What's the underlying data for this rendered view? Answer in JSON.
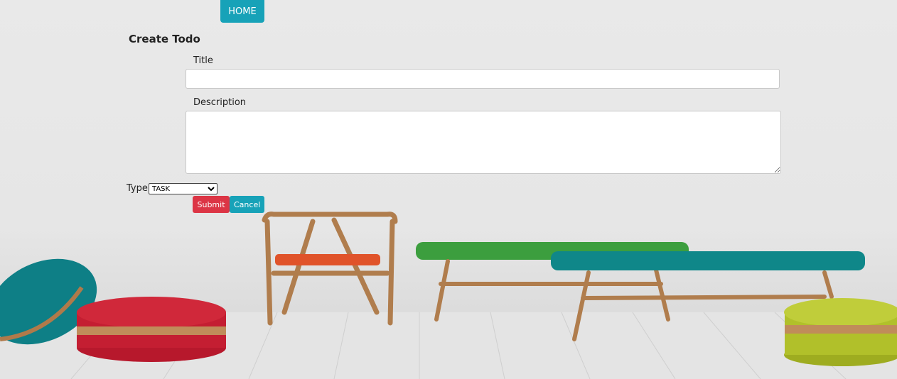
{
  "nav": {
    "home_label": "HOME"
  },
  "form": {
    "heading": "Create Todo",
    "title_label": "Title",
    "title_value": "",
    "description_label": "Description",
    "description_value": "",
    "type_label": "Type",
    "type_selected": "TASK",
    "submit_label": "Submit",
    "cancel_label": "Cancel"
  },
  "colors": {
    "home_button": "#17a2b8",
    "submit_button": "#dc3545",
    "cancel_button": "#17a2b8"
  },
  "background": {
    "description_icon": "furniture-photo"
  }
}
